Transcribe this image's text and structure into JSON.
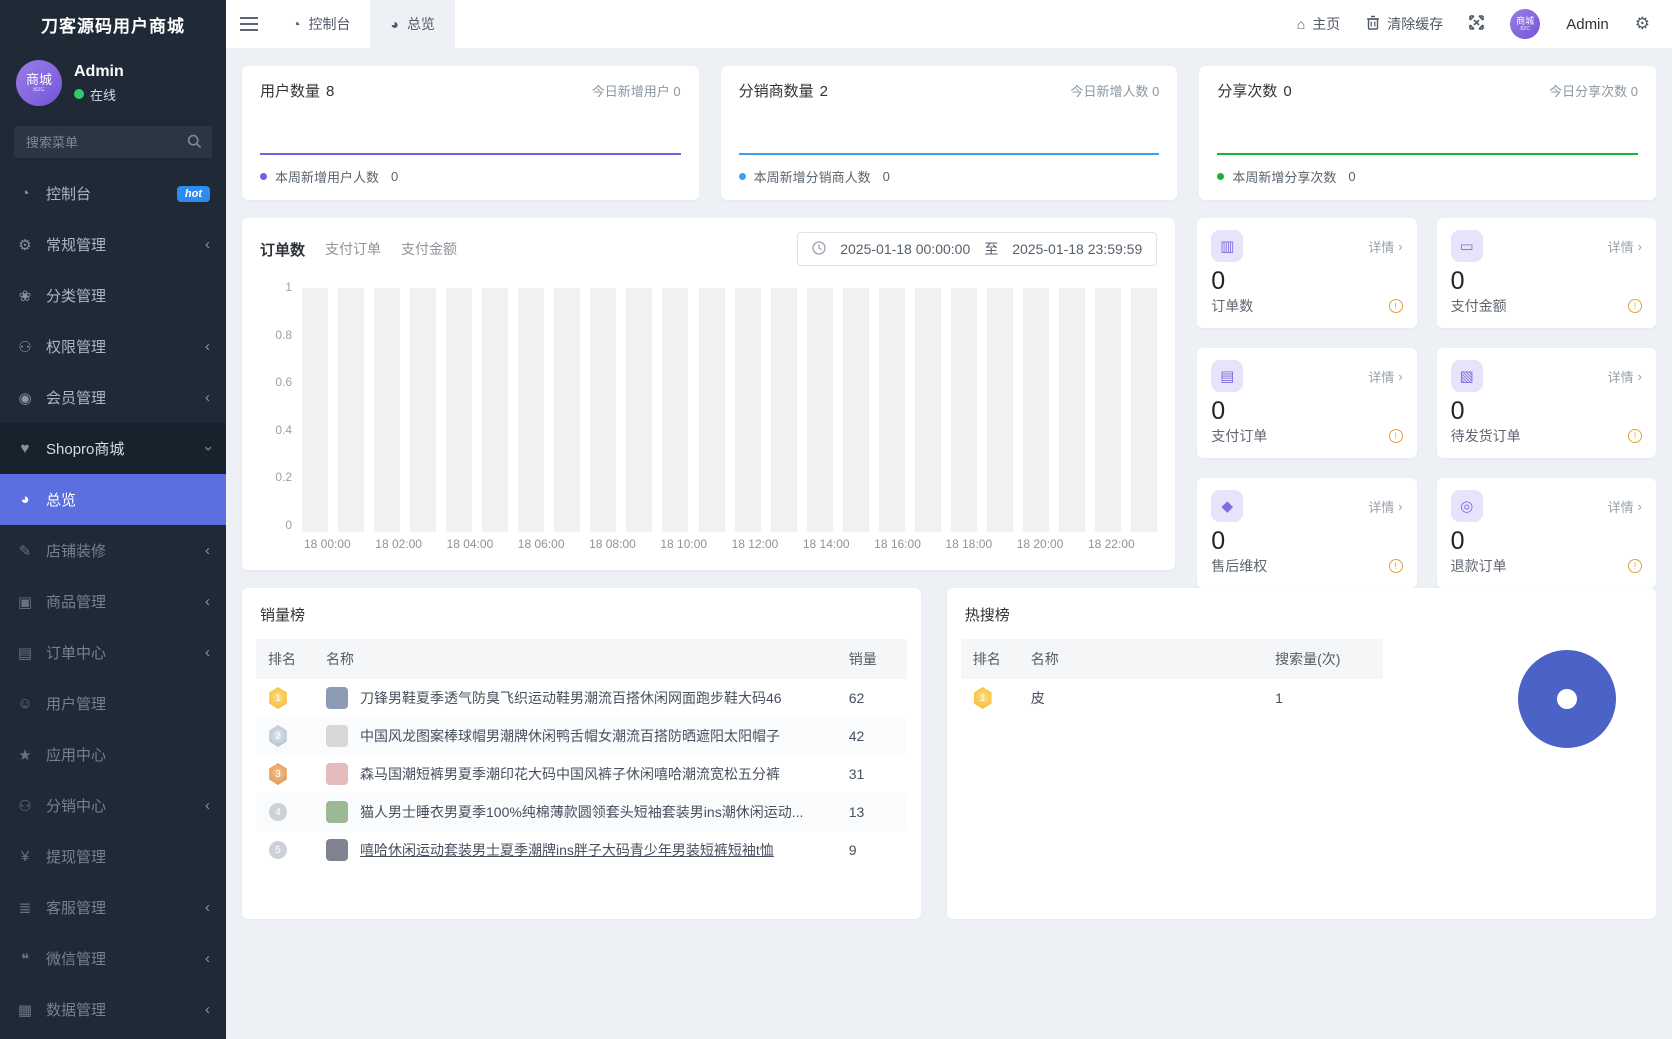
{
  "app": {
    "title": "刀客源码用户商城"
  },
  "sidebar": {
    "profile": {
      "name": "Admin",
      "status": "在线",
      "avatar_text": "商城",
      "avatar_subtext": "B2C"
    },
    "search": {
      "placeholder": "搜索菜单"
    },
    "menu": [
      {
        "label": "控制台",
        "icon": "dashboard-icon",
        "badge": "hot"
      },
      {
        "label": "常规管理",
        "icon": "gears-icon",
        "chevron": "left"
      },
      {
        "label": "分类管理",
        "icon": "leaf-icon"
      },
      {
        "label": "权限管理",
        "icon": "users-group-icon",
        "chevron": "left"
      },
      {
        "label": "会员管理",
        "icon": "member-icon",
        "chevron": "left"
      },
      {
        "label": "Shopro商城",
        "icon": "shop-heart-icon",
        "chevron": "down",
        "expanded": true
      },
      {
        "label": "总览",
        "icon": "pie-icon",
        "active": true
      },
      {
        "label": "店铺装修",
        "icon": "brush-icon",
        "chevron": "left"
      },
      {
        "label": "商品管理",
        "icon": "goods-icon",
        "chevron": "left"
      },
      {
        "label": "订单中心",
        "icon": "order-file-icon",
        "chevron": "left"
      },
      {
        "label": "用户管理",
        "icon": "user-icon"
      },
      {
        "label": "应用中心",
        "icon": "star-icon"
      },
      {
        "label": "分销中心",
        "icon": "distribution-icon",
        "chevron": "left"
      },
      {
        "label": "提现管理",
        "icon": "yen-icon"
      },
      {
        "label": "客服管理",
        "icon": "service-list-icon",
        "chevron": "left"
      },
      {
        "label": "微信管理",
        "icon": "wechat-icon",
        "chevron": "left"
      },
      {
        "label": "数据管理",
        "icon": "data-chart-icon",
        "chevron": "left"
      }
    ]
  },
  "topbar": {
    "tabs": [
      {
        "label": "控制台"
      },
      {
        "label": "总览",
        "active": true
      }
    ],
    "home_label": "主页",
    "clear_cache_label": "清除缓存",
    "user_name": "Admin"
  },
  "stats": [
    {
      "title": "用户数量",
      "value": "8",
      "today_label": "今日新增用户",
      "today_value": "0",
      "week_label": "本周新增用户人数",
      "week_value": "0",
      "color": "#7a5ce0"
    },
    {
      "title": "分销商数量",
      "value": "2",
      "today_label": "今日新增人数",
      "today_value": "0",
      "week_label": "本周新增分销商人数",
      "week_value": "0",
      "color": "#3d9ff0"
    },
    {
      "title": "分享次数",
      "value": "0",
      "today_label": "今日分享次数",
      "today_value": "0",
      "week_label": "本周新增分享次数",
      "week_value": "0",
      "color": "#19b138"
    }
  ],
  "order_chart": {
    "tabs": [
      "订单数",
      "支付订单",
      "支付金额"
    ],
    "active_tab": "订单数",
    "date_from": "2025-01-18 00:00:00",
    "date_separator": "至",
    "date_to": "2025-01-18 23:59:59"
  },
  "chart_data": [
    {
      "type": "bar",
      "title": "订单数",
      "x": [
        "18 00:00",
        "18 02:00",
        "18 04:00",
        "18 06:00",
        "18 08:00",
        "18 10:00",
        "18 12:00",
        "18 14:00",
        "18 16:00",
        "18 18:00",
        "18 20:00",
        "18 22:00"
      ],
      "bars_count": 24,
      "values": [
        0,
        0,
        0,
        0,
        0,
        0,
        0,
        0,
        0,
        0,
        0,
        0,
        0,
        0,
        0,
        0,
        0,
        0,
        0,
        0,
        0,
        0,
        0,
        0
      ],
      "ylim": [
        0,
        1
      ],
      "yticks": [
        "1",
        "0.8",
        "0.6",
        "0.4",
        "0.2",
        "0"
      ],
      "background_bars": true,
      "bar_color": "#f0f1f3",
      "grid": false,
      "legend": "none"
    },
    {
      "type": "pie",
      "title": "热搜榜",
      "labels": [
        "皮"
      ],
      "values": [
        1
      ],
      "donut": true,
      "colors": [
        "#4b63c6"
      ],
      "legend": "none"
    }
  ],
  "order_cards": [
    {
      "label": "订单数",
      "value": "0",
      "detail_label": "详情",
      "icon": "order-count-icon"
    },
    {
      "label": "支付金额",
      "value": "0",
      "detail_label": "详情",
      "icon": "pay-amount-icon"
    },
    {
      "label": "支付订单",
      "value": "0",
      "detail_label": "详情",
      "icon": "pay-order-icon"
    },
    {
      "label": "待发货订单",
      "value": "0",
      "detail_label": "详情",
      "icon": "to-ship-icon"
    },
    {
      "label": "售后维权",
      "value": "0",
      "detail_label": "详情",
      "icon": "aftersale-shield-icon"
    },
    {
      "label": "退款订单",
      "value": "0",
      "detail_label": "详情",
      "icon": "refund-icon"
    }
  ],
  "sales_rank": {
    "title": "销量榜",
    "headers": [
      "排名",
      "名称",
      "销量"
    ],
    "rows": [
      {
        "rank": "1",
        "name": "刀锋男鞋夏季透气防臭飞织运动鞋男潮流百搭休闲网面跑步鞋大码46",
        "value": "62"
      },
      {
        "rank": "2",
        "name": "中国风龙图案棒球帽男潮牌休闲鸭舌帽女潮流百搭防晒遮阳太阳帽子",
        "value": "42"
      },
      {
        "rank": "3",
        "name": "森马国潮短裤男夏季潮印花大码中国风裤子休闲嘻哈潮流宽松五分裤",
        "value": "31"
      },
      {
        "rank": "4",
        "name": "猫人男士睡衣男夏季100%纯棉薄款圆领套头短袖套装男ins潮休闲运动...",
        "value": "13"
      },
      {
        "rank": "5",
        "name": "嘻哈休闲运动套装男士夏季潮牌ins胖子大码青少年男装短裤短袖t恤",
        "value": "9"
      }
    ]
  },
  "hot_search": {
    "title": "热搜榜",
    "headers": [
      "排名",
      "名称",
      "搜索量(次)"
    ],
    "rows": [
      {
        "rank": "1",
        "name": "皮",
        "value": "1"
      }
    ]
  }
}
